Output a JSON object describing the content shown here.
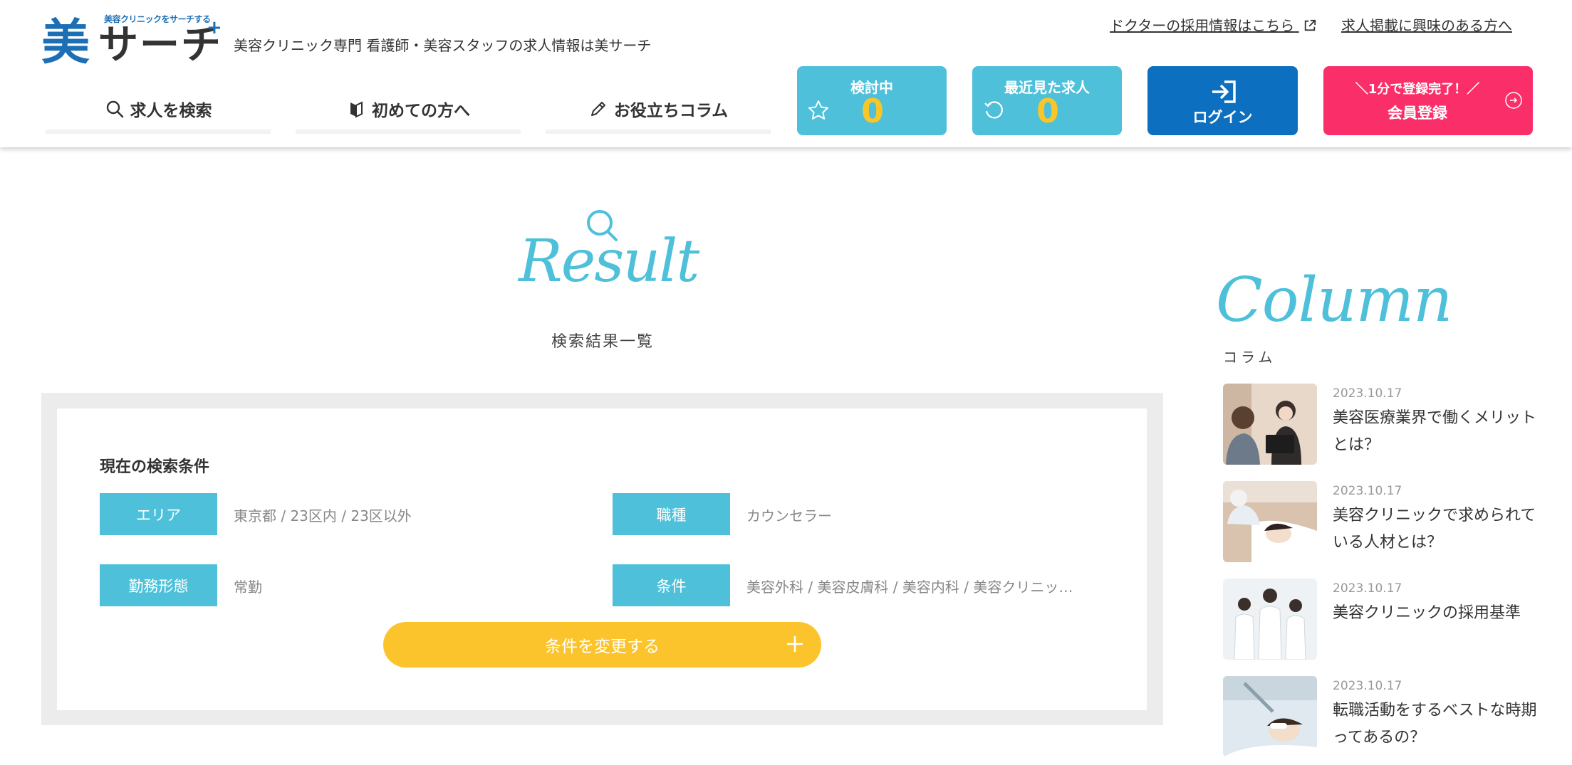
{
  "header": {
    "logo_tagline": "美容クリニックをサーチする",
    "logo_main": "美",
    "logo_search": "サーチ",
    "logo_plus": "+",
    "description": "美容クリニック専門 看護師・美容スタッフの求人情報は美サーチ",
    "doctor_link": "ドクターの採用情報はこちら",
    "advert_link": "求人掲載に興味のある方へ"
  },
  "nav": {
    "items": [
      {
        "label": "求人を検索",
        "icon": "search-icon"
      },
      {
        "label": "初めての方へ",
        "icon": "beginner-mark-icon"
      },
      {
        "label": "お役立ちコラム",
        "icon": "pencil-icon"
      }
    ]
  },
  "buttons": {
    "favorites": {
      "label": "検討中",
      "count": "0",
      "icon": "star-icon"
    },
    "recent": {
      "label": "最近見た求人",
      "count": "0",
      "icon": "history-icon"
    },
    "login": {
      "label": "ログイン",
      "icon": "login-icon"
    },
    "register": {
      "small": "＼1分で登録完了！／",
      "label": "会員登録",
      "icon": "arrow-circle-icon"
    }
  },
  "result": {
    "script_title": "Result",
    "subtitle": "検索結果一覧"
  },
  "conditions": {
    "heading": "現在の検索条件",
    "area": {
      "label": "エリア",
      "value": "東京都 / 23区内 / 23区以外"
    },
    "job": {
      "label": "職種",
      "value": "カウンセラー"
    },
    "employment": {
      "label": "勤務形態",
      "value": "常勤"
    },
    "condition": {
      "label": "条件",
      "value": "美容外科 / 美容皮膚科 / 美容内科 / 美容クリニッ…"
    },
    "change_button": "条件を変更する"
  },
  "column": {
    "script_title": "Column",
    "subtitle": "コラム",
    "items": [
      {
        "date": "2023.10.17",
        "title": "美容医療業界で働くメリットとは？"
      },
      {
        "date": "2023.10.17",
        "title": "美容クリニックで求められている人材とは？"
      },
      {
        "date": "2023.10.17",
        "title": "美容クリニックの採用基準"
      },
      {
        "date": "2023.10.17",
        "title": "転職活動をするベストな時期ってあるの？"
      }
    ]
  },
  "colors": {
    "accent_blue": "#4ec0da",
    "login_blue": "#0d6fbf",
    "register_pink": "#fa2f6a",
    "count_yellow": "#f7c629",
    "change_yellow": "#fcc42c"
  }
}
